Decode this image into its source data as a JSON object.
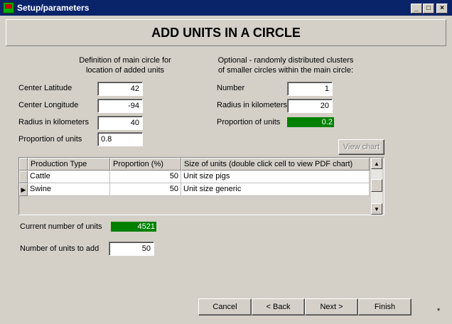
{
  "window": {
    "title": "Setup/parameters",
    "min_glyph": "_",
    "max_glyph": "□",
    "close_glyph": "×"
  },
  "header": {
    "title": "ADD UNITS IN A CIRCLE"
  },
  "main_circle": {
    "heading_line1": "Definition of main circle for",
    "heading_line2": "location of added units",
    "center_latitude": {
      "label": "Center Latitude",
      "value": "42"
    },
    "center_longitude": {
      "label": "Center Longitude",
      "value": "-94"
    },
    "radius": {
      "label": "Radius in kilometers",
      "value": "40"
    },
    "proportion": {
      "label": "Proportion of units",
      "value": "0.8"
    }
  },
  "clusters": {
    "heading_line1": "Optional - randomly distributed clusters",
    "heading_line2": "of smaller circles within the main circle:",
    "number": {
      "label": "Number",
      "value": "1"
    },
    "radius": {
      "label": "Radius in kilometers",
      "value": "20"
    },
    "proportion": {
      "label": "Proportion of units",
      "value": "0.2"
    },
    "view_chart_label": "View chart"
  },
  "table": {
    "columns": [
      "Production Type",
      "Proportion (%)",
      "Size of units (double click cell to view PDF chart)"
    ],
    "rows": [
      {
        "type": "Cattle",
        "proportion": "50",
        "size": "Unit size pigs"
      },
      {
        "type": "Swine",
        "proportion": "50",
        "size": "Unit size generic"
      }
    ],
    "selected_row_marker": "▶"
  },
  "current_units": {
    "label": "Current number of units",
    "value": "4521"
  },
  "units_to_add": {
    "label": "Number of units to add",
    "value": "50"
  },
  "buttons": {
    "cancel": "Cancel",
    "back": "< Back",
    "next": "Next >",
    "finish": "Finish"
  },
  "footer": {
    "asterisk": "*"
  },
  "colors": {
    "titlebar": "#0a246a",
    "face": "#d4d0c8",
    "bar_green": "#008000"
  }
}
